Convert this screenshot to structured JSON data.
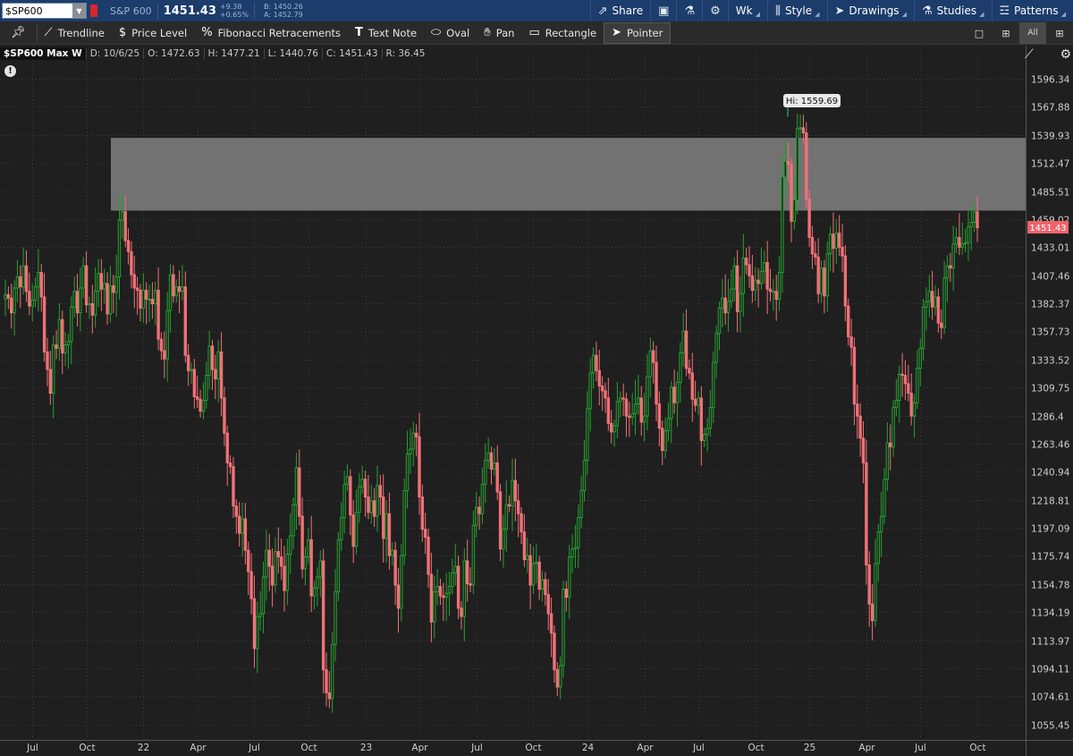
{
  "header": {
    "symbol": "$SP600",
    "name": "S&P 600",
    "last": "1451.43",
    "change": "+9.38",
    "change_pct": "+0.65%",
    "bid": "B: 1450.26",
    "ask": "A: 1452.79",
    "buttons": {
      "share": "Share",
      "timeframe": "Wk",
      "style": "Style",
      "drawings": "Drawings",
      "studies": "Studies",
      "patterns": "Patterns"
    }
  },
  "toolbar": {
    "trendline": "Trendline",
    "price_level": "Price Level",
    "fibonacci": "Fibonacci Retracements",
    "text_note": "Text Note",
    "oval": "Oval",
    "pan": "Pan",
    "rectangle": "Rectangle",
    "pointer": "Pointer",
    "layout_all": "All"
  },
  "info": {
    "title": "$SP600 Max W",
    "date": "D: 10/6/25",
    "open": "O: 1472.63",
    "high": "H: 1477.21",
    "low": "L: 1440.76",
    "close": "C: 1451.43",
    "range": "R: 36.45"
  },
  "colors": {
    "up": "#26a131",
    "down": "#f07177",
    "background": "#1f1f1f",
    "grid": "#3a3a3a",
    "zone": "#8a8a8a",
    "header": "#1c3c6b"
  },
  "chart_data": {
    "type": "candlestick",
    "title": "$SP600 Max W",
    "y_ticks": [
      "1596.34",
      "1567.88",
      "1539.93",
      "1512.47",
      "1485.51",
      "1459.02",
      "1433.01",
      "1407.46",
      "1382.37",
      "1357.73",
      "1333.52",
      "1309.75",
      "1286.4",
      "1263.46",
      "1240.94",
      "1218.81",
      "1197.09",
      "1175.74",
      "1154.78",
      "1134.19",
      "1113.97",
      "1094.11",
      "1074.61",
      "1055.45"
    ],
    "x_ticks": [
      "Jul",
      "Oct",
      "22",
      "Apr",
      "Jul",
      "Oct",
      "23",
      "Apr",
      "Jul",
      "Oct",
      "24",
      "Apr",
      "Jul",
      "Oct",
      "25",
      "Apr",
      "Jul",
      "Oct"
    ],
    "y_scale": "log",
    "ylim": [
      1045,
      1625
    ],
    "grid": true,
    "current_price_label": "1451.43",
    "high_label": "Hi: 1559.69",
    "resistance_zone": [
      1467,
      1537
    ],
    "weekly_close": [
      1390,
      1387,
      1374,
      1396,
      1406,
      1397,
      1416,
      1393,
      1380,
      1385,
      1397,
      1410,
      1388,
      1340,
      1325,
      1305,
      1346,
      1343,
      1368,
      1339,
      1346,
      1349,
      1379,
      1393,
      1374,
      1396,
      1416,
      1381,
      1382,
      1372,
      1393,
      1409,
      1395,
      1400,
      1373,
      1398,
      1392,
      1406,
      1458,
      1466,
      1439,
      1429,
      1408,
      1396,
      1394,
      1378,
      1394,
      1386,
      1386,
      1382,
      1394,
      1351,
      1341,
      1334,
      1376,
      1408,
      1389,
      1397,
      1393,
      1397,
      1337,
      1324,
      1325,
      1302,
      1300,
      1290,
      1299,
      1320,
      1345,
      1325,
      1317,
      1340,
      1301,
      1272,
      1248,
      1245,
      1214,
      1206,
      1193,
      1204,
      1180,
      1164,
      1144,
      1108,
      1131,
      1133,
      1160,
      1180,
      1168,
      1154,
      1179,
      1175,
      1168,
      1150,
      1177,
      1191,
      1215,
      1244,
      1206,
      1166,
      1175,
      1188,
      1146,
      1152,
      1160,
      1172,
      1093,
      1077,
      1073,
      1111,
      1149,
      1188,
      1205,
      1231,
      1237,
      1207,
      1183,
      1209,
      1229,
      1235,
      1221,
      1209,
      1218,
      1206,
      1230,
      1221,
      1189,
      1208,
      1176,
      1180,
      1154,
      1137,
      1176,
      1226,
      1255,
      1259,
      1272,
      1269,
      1221,
      1196,
      1190,
      1162,
      1127,
      1149,
      1153,
      1146,
      1145,
      1148,
      1153,
      1163,
      1168,
      1137,
      1131,
      1172,
      1155,
      1154,
      1199,
      1213,
      1208,
      1231,
      1250,
      1256,
      1243,
      1248,
      1225,
      1181,
      1196,
      1215,
      1214,
      1234,
      1218,
      1208,
      1194,
      1173,
      1176,
      1154,
      1170,
      1171,
      1151,
      1158,
      1147,
      1133,
      1119,
      1093,
      1081,
      1096,
      1151,
      1145,
      1175,
      1181,
      1182,
      1205,
      1226,
      1250,
      1292,
      1322,
      1337,
      1324,
      1311,
      1307,
      1301,
      1280,
      1273,
      1278,
      1298,
      1301,
      1300,
      1286,
      1285,
      1288,
      1296,
      1301,
      1281,
      1286,
      1319,
      1341,
      1331,
      1296,
      1276,
      1258,
      1274,
      1284,
      1310,
      1297,
      1314,
      1339,
      1358,
      1326,
      1322,
      1300,
      1295,
      1301,
      1266,
      1271,
      1276,
      1293,
      1331,
      1356,
      1378,
      1387,
      1374,
      1384,
      1395,
      1416,
      1375,
      1391,
      1423,
      1417,
      1407,
      1394,
      1403,
      1400,
      1411,
      1419,
      1395,
      1393,
      1393,
      1386,
      1410,
      1499,
      1514,
      1511,
      1457,
      1477,
      1546,
      1547,
      1542,
      1478,
      1442,
      1427,
      1424,
      1391,
      1414,
      1389,
      1427,
      1445,
      1432,
      1446,
      1433,
      1425,
      1380,
      1353,
      1344,
      1296,
      1286,
      1268,
      1248,
      1169,
      1140,
      1128,
      1170,
      1194,
      1206,
      1235,
      1264,
      1261,
      1293,
      1299,
      1321,
      1320,
      1313,
      1305,
      1286,
      1297,
      1326,
      1343,
      1379,
      1384,
      1393,
      1379,
      1388,
      1365,
      1361,
      1405,
      1416,
      1414,
      1436,
      1442,
      1433,
      1436,
      1437,
      1452,
      1456,
      1466,
      1451
    ]
  }
}
